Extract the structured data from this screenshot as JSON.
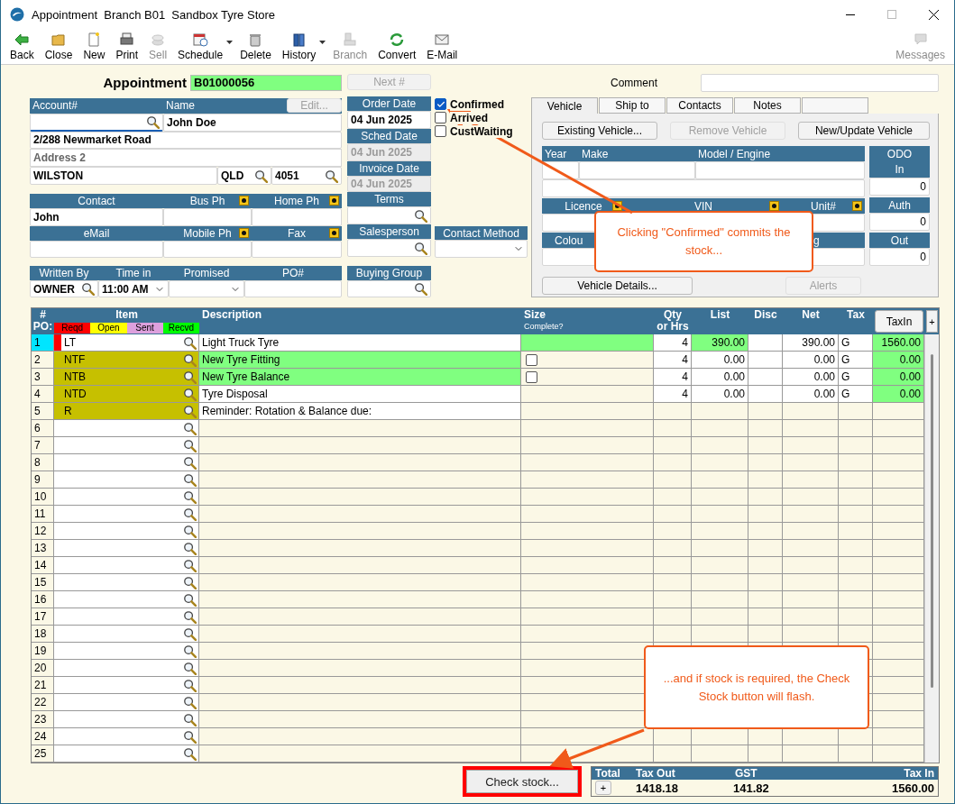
{
  "window": {
    "title": "Appointment  Branch B01  Sandbox Tyre Store"
  },
  "toolbar": [
    {
      "label": "Back",
      "kind": "back",
      "disabled": false,
      "dropdown": false
    },
    {
      "label": "Close",
      "kind": "folder",
      "disabled": false,
      "dropdown": false
    },
    {
      "label": "New",
      "kind": "page",
      "disabled": false,
      "dropdown": false
    },
    {
      "label": "Print",
      "kind": "printer",
      "disabled": false,
      "dropdown": false
    },
    {
      "label": "Sell",
      "kind": "coins",
      "disabled": true,
      "dropdown": false
    },
    {
      "label": "Schedule",
      "kind": "calendar",
      "disabled": false,
      "dropdown": true
    },
    {
      "label": "Delete",
      "kind": "trash",
      "disabled": false,
      "dropdown": false
    },
    {
      "label": "History",
      "kind": "binders",
      "disabled": false,
      "dropdown": true
    },
    {
      "label": "Branch",
      "kind": "blocks",
      "disabled": true,
      "dropdown": false
    },
    {
      "label": "Convert",
      "kind": "cycle",
      "disabled": false,
      "dropdown": false
    },
    {
      "label": "E-Mail",
      "kind": "envelope",
      "disabled": false,
      "dropdown": false
    }
  ],
  "messages": {
    "label": "Messages",
    "disabled": true
  },
  "appointment": {
    "label": "Appointment",
    "number": "B01000056",
    "next_button": {
      "label": "Next #",
      "disabled": true
    }
  },
  "comment": {
    "label": "Comment"
  },
  "account": {
    "headers": [
      "Account#",
      "Name"
    ],
    "edit_button": {
      "label": "Edit...",
      "disabled": true
    },
    "name": "John Doe",
    "address1": "2/288 Newmarket Road",
    "address2_placeholder": "Address 2",
    "city": "WILSTON",
    "state": "QLD",
    "postcode": "4051"
  },
  "contact": {
    "headers": [
      {
        "label": "Contact",
        "flag": false
      },
      {
        "label": "Bus Ph",
        "flag": true
      },
      {
        "label": "Home Ph",
        "flag": true
      }
    ],
    "contact": "John",
    "headers2": [
      {
        "label": "eMail",
        "flag": false
      },
      {
        "label": "Mobile Ph",
        "flag": true
      },
      {
        "label": "Fax",
        "flag": true
      }
    ]
  },
  "written": {
    "headers": [
      "Written By",
      "Time in",
      "Promised",
      "PO#"
    ],
    "written_by": "OWNER",
    "time_in": "11:00 AM"
  },
  "dates": [
    {
      "label": "Order Date",
      "value": "04 Jun 2025",
      "disabled": false
    },
    {
      "label": "Sched Date",
      "value": "04 Jun 2025",
      "disabled": true
    },
    {
      "label": "Invoice Date",
      "value": "04 Jun 2025",
      "disabled": true
    }
  ],
  "terms": {
    "label": "Terms"
  },
  "salesperson": {
    "label": "Salesperson"
  },
  "buying_group": {
    "label": "Buying Group"
  },
  "checkboxes": [
    {
      "label": "Confirmed",
      "checked": true
    },
    {
      "label": "Arrived",
      "checked": false
    },
    {
      "label": "CustWaiting",
      "checked": false
    }
  ],
  "contact_method": {
    "label": "Contact Method"
  },
  "tabs": [
    {
      "label": "Vehicle",
      "selected": true
    },
    {
      "label": "Ship to",
      "selected": false
    },
    {
      "label": "Contacts",
      "selected": false
    },
    {
      "label": "Notes",
      "selected": false
    },
    {
      "selected": false
    }
  ],
  "vehicle": {
    "buttons": [
      {
        "label": "Existing Vehicle...",
        "disabled": false
      },
      {
        "label": "Remove Vehicle",
        "disabled": true
      },
      {
        "label": "New/Update Vehicle",
        "disabled": false
      }
    ],
    "header1": [
      "Year",
      "Make",
      "Model / Engine"
    ],
    "header2": [
      {
        "label": "Licence",
        "flag": true
      },
      {
        "label": "VIN",
        "flag": true
      },
      {
        "label": "Unit#",
        "flag": true
      }
    ],
    "header3": [
      "Colou",
      "g"
    ],
    "odo": [
      {
        "label": [
          "ODO",
          "In"
        ],
        "value": "0"
      },
      {
        "label": [
          "Auth"
        ],
        "value": "0"
      },
      {
        "label": [
          "Out"
        ],
        "value": "0"
      }
    ],
    "bottom_buttons": [
      {
        "label": "Vehicle Details...",
        "disabled": false
      },
      {
        "label": "Alerts",
        "disabled": true
      }
    ]
  },
  "table": {
    "columns": {
      "number": "#",
      "po": "PO:",
      "item": "Item",
      "description": "Description",
      "size": "Size",
      "size_sub": "Complete?",
      "qty": [
        "Qty",
        "or Hrs"
      ],
      "list": "List",
      "disc": "Disc",
      "net": "Net",
      "tax": "Tax"
    },
    "taxin_button": "TaxIn",
    "add_button": "+",
    "legend": [
      {
        "label": "Reqd",
        "color": "#ff0000"
      },
      {
        "label": "Open",
        "color": "#ffff00"
      },
      {
        "label": "Sent",
        "color": "#dda0dd"
      },
      {
        "label": "Recvd",
        "color": "#00ff00"
      }
    ],
    "rows": [
      {
        "no": "1",
        "selected": true,
        "color": "#ff0000",
        "item": "LT",
        "item_highlight": false,
        "description": "Light Truck Tyre",
        "description_highlight": false,
        "size": {
          "kind": "bar"
        },
        "qty": "4",
        "list": "390.00",
        "list_highlight": true,
        "net": "390.00",
        "tax": "G",
        "tax_in": "1560.00"
      },
      {
        "no": "2",
        "selected": false,
        "item": "NTF",
        "item_highlight": true,
        "description": "New Tyre Fitting",
        "description_highlight": true,
        "size": {
          "kind": "checkbox",
          "checked": false
        },
        "qty": "4",
        "list": "0.00",
        "list_highlight": false,
        "net": "0.00",
        "tax": "G",
        "tax_in": "0.00"
      },
      {
        "no": "3",
        "selected": false,
        "item": "NTB",
        "item_highlight": true,
        "description": "New Tyre Balance",
        "description_highlight": true,
        "size": {
          "kind": "checkbox",
          "checked": false
        },
        "qty": "4",
        "list": "0.00",
        "list_highlight": false,
        "net": "0.00",
        "tax": "G",
        "tax_in": "0.00"
      },
      {
        "no": "4",
        "selected": false,
        "item": "NTD",
        "item_highlight": true,
        "description": "Tyre Disposal",
        "description_highlight": false,
        "size": {
          "kind": "none"
        },
        "qty": "4",
        "list": "0.00",
        "list_highlight": false,
        "net": "0.00",
        "tax": "G",
        "tax_in": "0.00"
      },
      {
        "no": "5",
        "selected": false,
        "item": "R",
        "item_highlight": true,
        "description": "Reminder: Rotation & Balance due:",
        "description_highlight": false
      },
      {
        "no": "6",
        "selected": false
      },
      {
        "no": "7",
        "selected": false
      },
      {
        "no": "8",
        "selected": false
      },
      {
        "no": "9",
        "selected": false
      },
      {
        "no": "10",
        "selected": false
      },
      {
        "no": "11",
        "selected": false
      },
      {
        "no": "12",
        "selected": false
      },
      {
        "no": "13",
        "selected": false
      },
      {
        "no": "14",
        "selected": false
      },
      {
        "no": "15",
        "selected": false
      },
      {
        "no": "16",
        "selected": false
      },
      {
        "no": "17",
        "selected": false
      },
      {
        "no": "18",
        "selected": false
      },
      {
        "no": "19",
        "selected": false
      },
      {
        "no": "20",
        "selected": false
      },
      {
        "no": "21",
        "selected": false
      },
      {
        "no": "22",
        "selected": false
      },
      {
        "no": "23",
        "selected": false
      },
      {
        "no": "24",
        "selected": false
      },
      {
        "no": "25",
        "selected": false
      }
    ]
  },
  "check_stock_button": {
    "label": "Check stock...",
    "highlighted": true
  },
  "totals": {
    "headers": [
      "Total",
      "Tax Out",
      "GST",
      "Tax In"
    ],
    "expand_button": "+",
    "tax_out": "1418.18",
    "gst": "141.82",
    "tax_in": "1560.00"
  },
  "callouts": [
    {
      "text": "Clicking \"Confirmed\" commits the stock..."
    },
    {
      "text": "...and if stock is required, the Check Stock button will flash."
    }
  ]
}
